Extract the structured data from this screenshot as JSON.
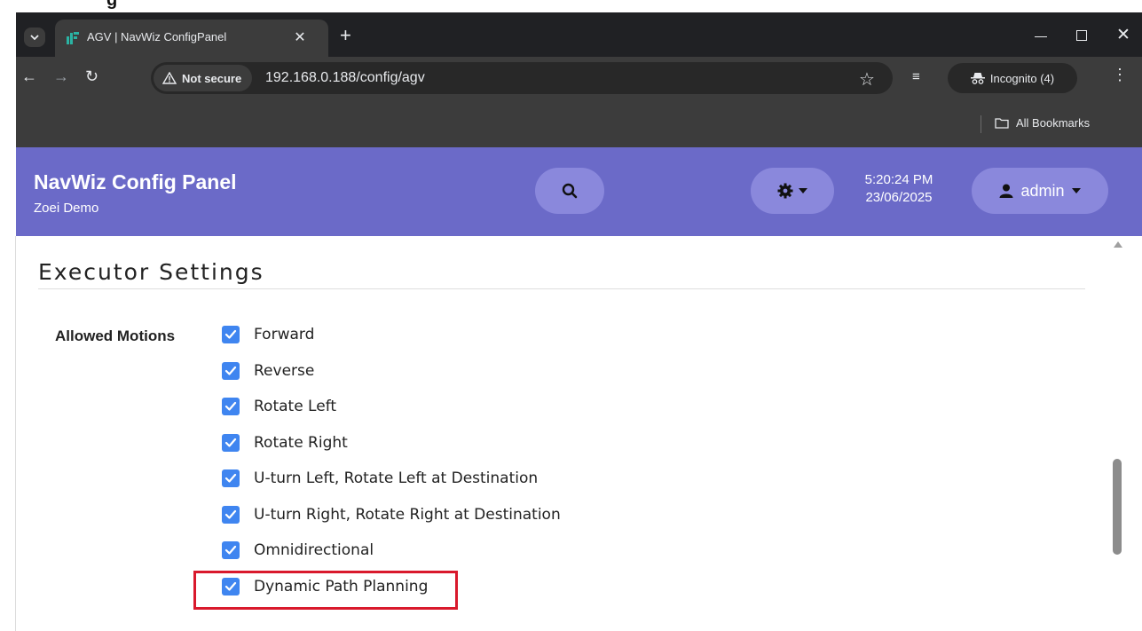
{
  "top_partial_text": "g",
  "browser": {
    "tab_title": "AGV | NavWiz ConfigPanel",
    "security_label": "Not secure",
    "url": "192.168.0.188/config/agv",
    "incognito_label": "Incognito (4)",
    "bookmarks_label": "All Bookmarks"
  },
  "header": {
    "title": "NavWiz Config Panel",
    "subtitle": "Zoei Demo",
    "time": "5:20:24 PM",
    "date": "23/06/2025",
    "user": "admin",
    "color": "#6b6ac8"
  },
  "main": {
    "section_title": "Executor Settings",
    "field_label": "Allowed Motions",
    "options": [
      {
        "label": "Forward",
        "checked": true
      },
      {
        "label": "Reverse",
        "checked": true
      },
      {
        "label": "Rotate Left",
        "checked": true
      },
      {
        "label": "Rotate Right",
        "checked": true
      },
      {
        "label": "U-turn Left, Rotate Left at Destination",
        "checked": true
      },
      {
        "label": "U-turn Right, Rotate Right at Destination",
        "checked": true
      },
      {
        "label": "Omnidirectional",
        "checked": true
      },
      {
        "label": "Dynamic Path Planning",
        "checked": true
      }
    ],
    "highlighted_option": "Dynamic Path Planning",
    "checkbox_color": "#3f85f0",
    "highlight_color": "#d9192c"
  }
}
